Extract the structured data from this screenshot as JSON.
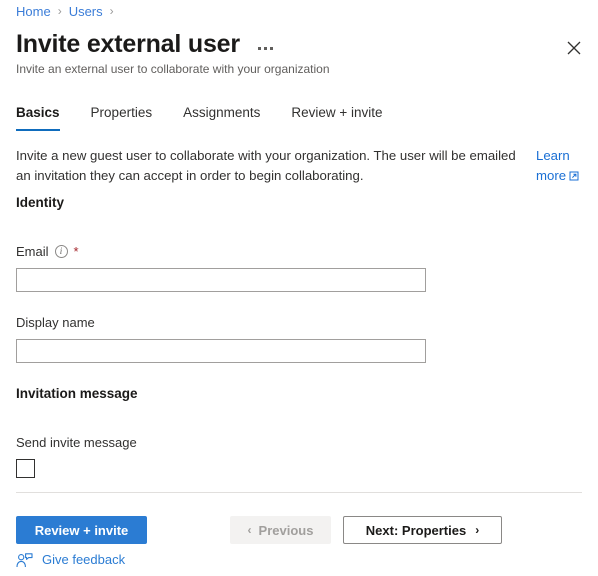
{
  "breadcrumb": {
    "items": [
      {
        "label": "Home"
      },
      {
        "label": "Users"
      }
    ],
    "separator": "›"
  },
  "header": {
    "title": "Invite external user",
    "subtitle": "Invite an external user to collaborate with your organization",
    "more_menu": "···",
    "close_label": "Close"
  },
  "tabs": [
    {
      "label": "Basics",
      "active": true
    },
    {
      "label": "Properties",
      "active": false
    },
    {
      "label": "Assignments",
      "active": false
    },
    {
      "label": "Review + invite",
      "active": false
    }
  ],
  "description": {
    "text": "Invite a new guest user to collaborate with your organization. The user will be emailed an invitation they can accept in order to begin collaborating.",
    "link_label": "Learn more",
    "link_icon": "external-link-icon"
  },
  "sections": {
    "identity": {
      "heading": "Identity",
      "email": {
        "label": "Email",
        "info_icon": "i",
        "required_mark": "*",
        "value": "",
        "placeholder": ""
      },
      "display_name": {
        "label": "Display name",
        "value": "",
        "placeholder": ""
      }
    },
    "invitation": {
      "heading": "Invitation message",
      "send_invite": {
        "label": "Send invite message",
        "checked": false
      }
    }
  },
  "footer": {
    "review_invite_label": "Review + invite",
    "previous_label": "Previous",
    "previous_icon": "‹",
    "previous_disabled": true,
    "next_label": "Next: Properties",
    "next_icon": "›",
    "feedback_label": "Give feedback",
    "feedback_icon": "person-feedback-icon"
  },
  "colors": {
    "accent": "#2b7cd3",
    "link": "#1a6fd4",
    "tab_underline": "#0f6cbd",
    "required": "#a4262c",
    "border": "#a19f9d",
    "divider": "#e1dfdd"
  }
}
